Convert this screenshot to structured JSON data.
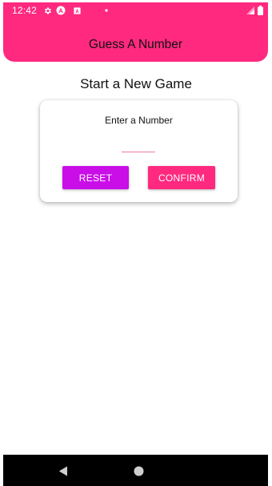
{
  "status_bar": {
    "time": "12:42",
    "icons": [
      "gear-icon",
      "brand-a-icon",
      "android-a-icon",
      "notification-dot-icon",
      "signal-icon",
      "battery-icon"
    ]
  },
  "header": {
    "title": "Guess A Number"
  },
  "main": {
    "title": "Start a New Game",
    "card": {
      "label": "Enter a Number",
      "input_value": "",
      "reset_label": "RESET",
      "confirm_label": "CONFIRM"
    }
  },
  "nav_bar": {
    "icons": [
      "back-icon",
      "home-icon"
    ]
  },
  "colors": {
    "primary": "#ff297f",
    "accent": "#c90ee8",
    "input_underline": "#f07ba7"
  }
}
